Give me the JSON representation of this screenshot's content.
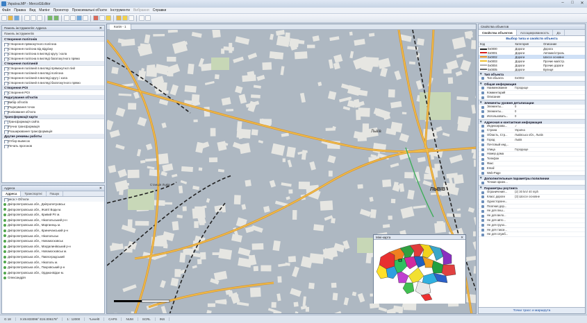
{
  "window": {
    "title": "Україна.MP - MercoGEditor"
  },
  "menu": [
    {
      "label": "Файл",
      "dim": false
    },
    {
      "label": "Правка",
      "dim": false
    },
    {
      "label": "Вид",
      "dim": false
    },
    {
      "label": "Мапінг",
      "dim": false
    },
    {
      "label": "Проектор",
      "dim": false
    },
    {
      "label": "Проксимальні об'єкти",
      "dim": false
    },
    {
      "label": "Інструменти",
      "dim": false
    },
    {
      "label": "Вибрання",
      "dim": true
    },
    {
      "label": "Справки",
      "dim": false
    }
  ],
  "tools_panel": {
    "title": "Панель інструментів: Адреса",
    "subtitle": "Панель інструментів",
    "sections": [
      {
        "title": "Створення полігонів",
        "items": [
          "Створення прямокутного полігона",
          "Створення полігона від відрізку",
          "Створення полігона в вигляді кругу і кола",
          "Створення полігона в вигляді багатокутного прямо"
        ]
      },
      {
        "title": "Створення полілиній",
        "items": [
          "Створення полілинії в вигляді прямокутної лінії",
          "Створення полілинії в вигляді полігона",
          "Створення полілинії в вигляді кругу і кола",
          "Створення полілинії в вигляді багатокутного прямо"
        ]
      },
      {
        "title": "Створення POI",
        "items": [
          "Створення POI"
        ]
      },
      {
        "title": "Редагування об'єктів",
        "items": [
          "Вибір об'єктів",
          "Редагування точок",
          "Копіювання об'єкта"
        ]
      },
      {
        "title": "Трансформації карти",
        "items": [
          "Трансформація сайта",
          "Ручна трансформація",
          "Розширювання трансформація"
        ]
      },
      {
        "title": "Другие режимы работы",
        "items": [
          "Отбор вывесок",
          "Печать прогонов"
        ]
      }
    ]
  },
  "address_panel": {
    "title": "Адреса",
    "tabs": [
      "Адреса",
      "Транспортні",
      "Пошук"
    ],
    "header": "Адреса > Об'єкти",
    "rows": [
      "Дніпропетровська обл., Дніпропетровськ",
      "Дніпропетровська обл., Жовті Води м.",
      "Дніпропетровська обл., Кривий Ріг м.",
      "Дніпропетровська обл., Нікопольський р-н",
      "Дніпропетровська обл., Марганець м.",
      "Дніпропетровська обл., Криничанський р-н",
      "Дніпропетровська обл., Нікопольськ",
      "Дніпропетровська обл., Новомосковськ",
      "Дніпропетровська обл., Магдалинівський р-н",
      "Дніпропетровська обл., Новомосковськ м.",
      "Дніпропетровська обл., Павлоградський",
      "Дніпропетровська обл., Нікополь м.",
      "Дніпропетровська обл., Покровський р-н",
      "Дніпропетровська обл., Орджонікідзе м.",
      "Олександрія"
    ]
  },
  "map": {
    "tab": "Копія - 1",
    "labels": {
      "lviv": "Львів",
      "lviv2": "ЛЬВІВ",
      "station": "Станція Львів"
    }
  },
  "minimap": {
    "title": "Міні-карта"
  },
  "status": [
    "G 18",
    "X:49.833096° E24.006178°",
    "1 : 12000",
    "*Level0",
    "CAPS",
    "NUM",
    "SCRL",
    "INS"
  ],
  "right_panel": {
    "title": "Свойства объектов",
    "tabs": [
      "Свойства объектов",
      "Ассоциированность",
      "Дз"
    ],
    "subtitle": "Выбор типа и свойств объекта",
    "table_headers": [
      "Код",
      "Категория",
      "Описание"
    ],
    "types": [
      {
        "code": "0x0000",
        "cat": "Дороги",
        "desc": "Дорога",
        "color": "#2b2b2b"
      },
      {
        "code": "0x0001",
        "cat": "Дороги",
        "desc": "Автомагістраль",
        "color": "#d62020"
      },
      {
        "code": "0x0002",
        "cat": "Дороги",
        "desc": "Шоссе основне",
        "color": "#e89020"
      },
      {
        "code": "0x0003",
        "cat": "Дороги",
        "desc": "Прочие магістр.",
        "color": "#f0c030"
      },
      {
        "code": "0x0004",
        "cat": "Дороги",
        "desc": "Прочие дороги",
        "color": "#b0b0b0"
      },
      {
        "code": "0x0005",
        "cat": "Дороги",
        "desc": "Вулиця",
        "color": "#6a6a6a"
      }
    ],
    "groups": [
      {
        "title": "Тип объекта",
        "props": [
          [
            "Тип объекта",
            "0x0002"
          ]
        ]
      },
      {
        "title": "Общая информация",
        "props": [
          [
            "Наименование",
            "Городище"
          ],
          [
            "Комментарий",
            ""
          ],
          [
            "Описание",
            ""
          ]
        ]
      },
      {
        "title": "Элементы уровня детализации",
        "props": [
          [
            "Элементы...",
            "0"
          ],
          [
            "Элементы...",
            "0"
          ],
          [
            "Использовать...",
            "0"
          ]
        ]
      },
      {
        "title": "Адресная и контактная информация",
        "props": [
          [
            "Индексирова...",
            "✓"
          ],
          [
            "Страна",
            "Україна"
          ],
          [
            "Область, Стр...",
            "Львівська обл., Львів"
          ],
          [
            "Город",
            "Львів"
          ],
          [
            "Почтовый инд...",
            ""
          ],
          [
            "Улица",
            "Городище"
          ],
          [
            "Номер дома",
            ""
          ],
          [
            "Телефон",
            ""
          ],
          [
            "Факс",
            ""
          ],
          [
            "Email",
            ""
          ],
          [
            "Web-Page",
            ""
          ]
        ]
      },
      {
        "title": "Дополнительные параметры полилинии",
        "props": [
          [
            "Точная ориен...",
            ""
          ]
        ]
      },
      {
        "title": "Параметры роутинга",
        "props": [
          [
            "Ограничения...",
            "(2) 30 km/ 40 mph"
          ],
          [
            "Класс дороги",
            "(3) Шоссе основне"
          ],
          [
            "Односторонн...",
            ""
          ],
          [
            "Платная дор...",
            ""
          ],
          [
            "Не для пеш...",
            ""
          ],
          [
            "Не для вело...",
            ""
          ],
          [
            "Не для авто...",
            ""
          ],
          [
            "Не для грузо...",
            ""
          ],
          [
            "Не для такси...",
            ""
          ],
          [
            "Не для служб...",
            ""
          ]
        ]
      }
    ],
    "footer": "Точки трасс и маршрута"
  }
}
